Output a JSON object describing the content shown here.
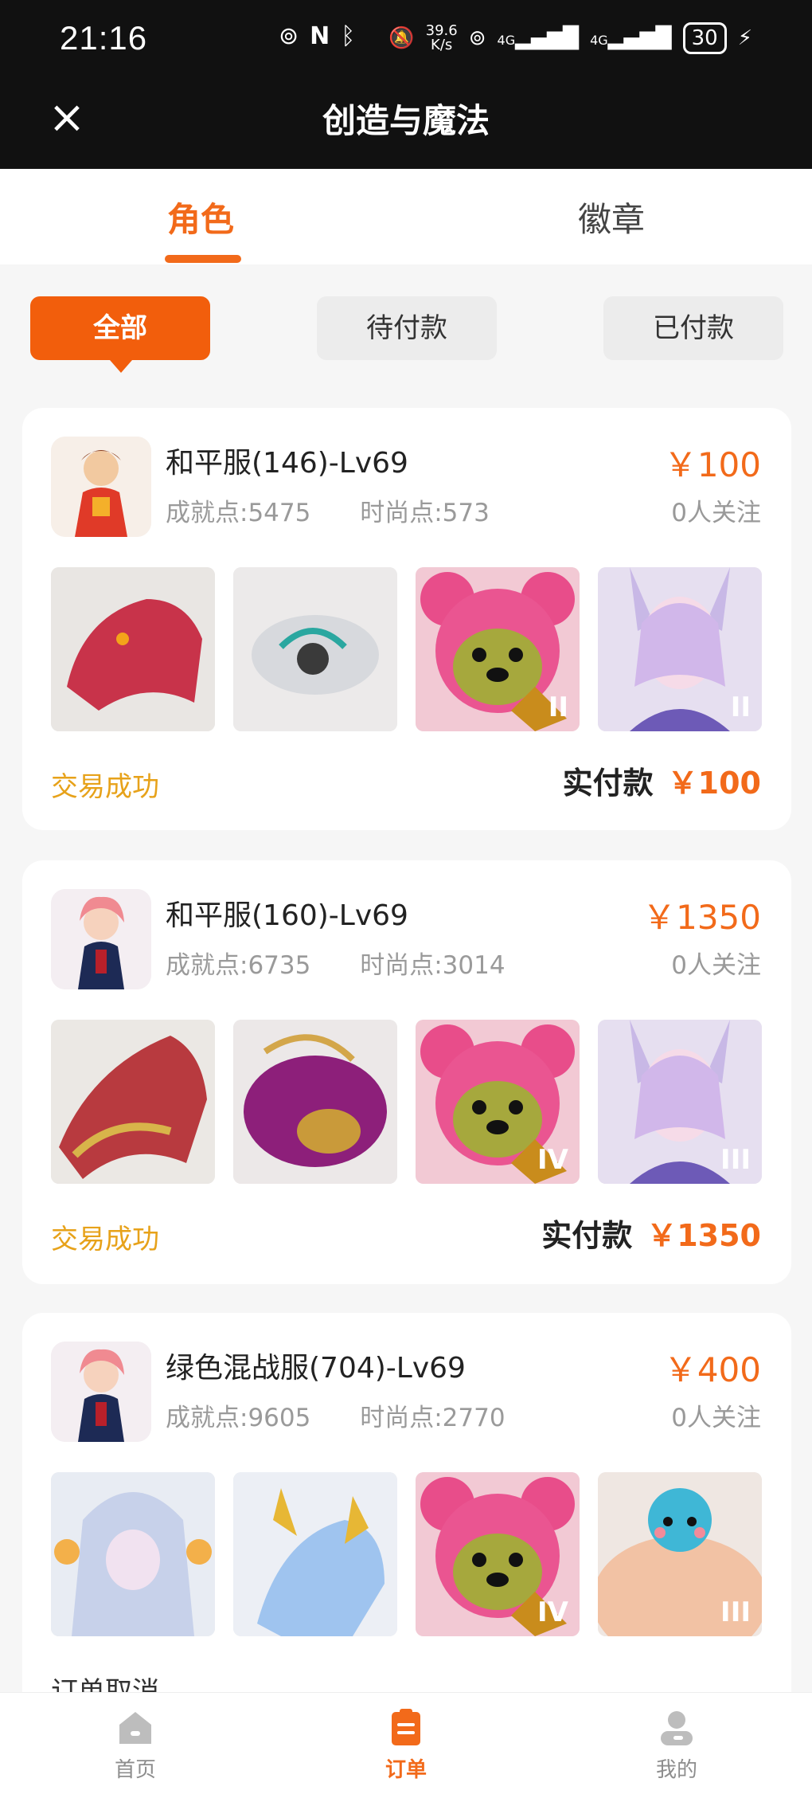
{
  "status_bar": {
    "time": "21:16",
    "net_speed_value": "39.6",
    "net_speed_unit": "K/s",
    "battery": "30",
    "net1": "4G",
    "net2": "4G"
  },
  "header": {
    "title": "创造与魔法",
    "close_icon": "close-icon"
  },
  "tabs": [
    {
      "label": "角色",
      "active": true
    },
    {
      "label": "徽章",
      "active": false
    }
  ],
  "filters": [
    {
      "label": "全部",
      "active": true
    },
    {
      "label": "待付款",
      "active": false
    },
    {
      "label": "已付款",
      "active": false
    }
  ],
  "orders": [
    {
      "name": "和平服(146)-Lv69",
      "achievement": "成就点:5475",
      "fashion": "时尚点:573",
      "price": "￥100",
      "followers": "0人关注",
      "status": "交易成功",
      "paid_label": "实付款",
      "paid_amount": "￥100",
      "thumb_badges": [
        "",
        "",
        "II",
        "II"
      ]
    },
    {
      "name": "和平服(160)-Lv69",
      "achievement": "成就点:6735",
      "fashion": "时尚点:3014",
      "price": "￥1350",
      "followers": "0人关注",
      "status": "交易成功",
      "paid_label": "实付款",
      "paid_amount": "￥1350",
      "thumb_badges": [
        "",
        "",
        "IV",
        "III"
      ]
    },
    {
      "name": "绿色混战服(704)-Lv69",
      "achievement": "成就点:9605",
      "fashion": "时尚点:2770",
      "price": "￥400",
      "followers": "0人关注",
      "status": "订单取消",
      "thumb_badges": [
        "",
        "",
        "IV",
        "III"
      ]
    }
  ],
  "bottom_nav": [
    {
      "label": "首页",
      "icon": "home-icon",
      "active": false
    },
    {
      "label": "订单",
      "icon": "order-icon",
      "active": true
    },
    {
      "label": "我的",
      "icon": "profile-icon",
      "active": false
    }
  ],
  "colors": {
    "accent": "#f26a1a",
    "success": "#e7a21a",
    "header_bg": "#111111"
  }
}
